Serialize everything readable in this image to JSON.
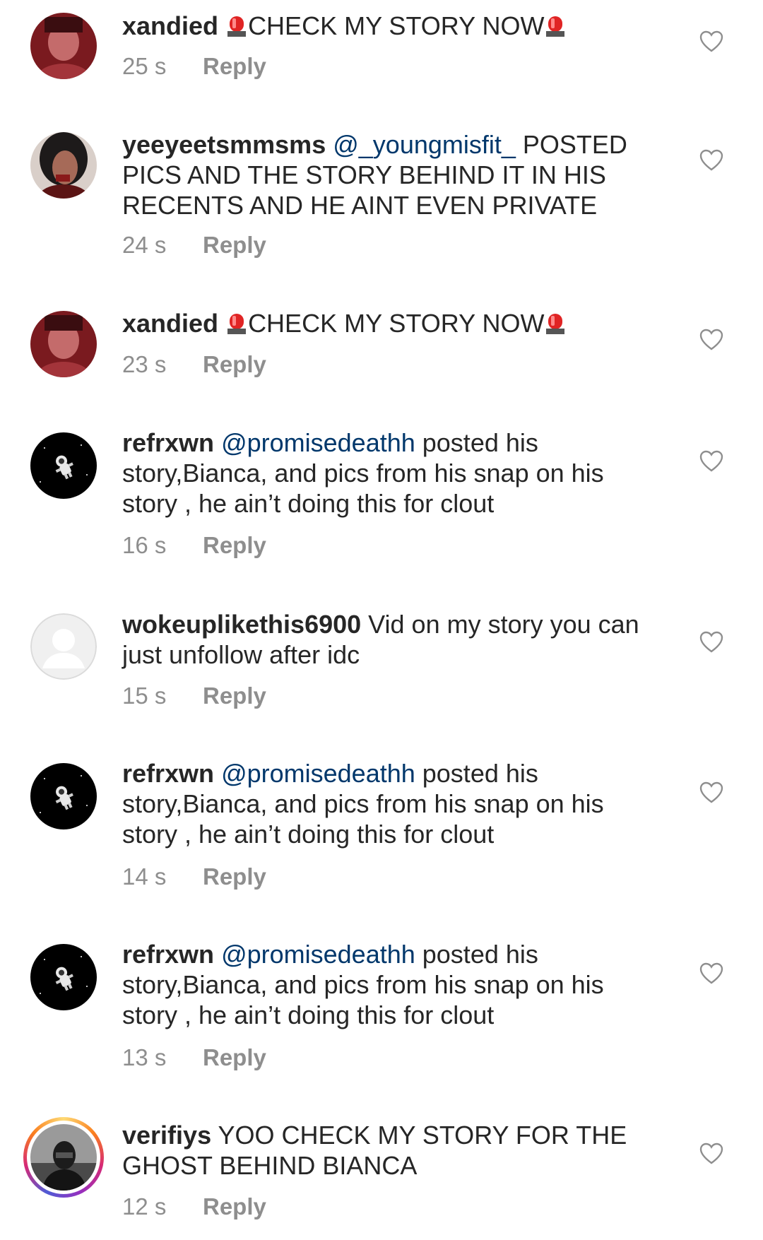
{
  "comments": [
    {
      "username": "xandied",
      "segments": [
        {
          "type": "emoji",
          "name": "police-light"
        },
        {
          "type": "text",
          "value": "CHECK MY STORY NOW"
        },
        {
          "type": "emoji",
          "name": "police-light"
        }
      ],
      "time": "25 s",
      "reply_label": "Reply",
      "avatar": "photo-selfie-red"
    },
    {
      "username": "yeeyeetsmmsms",
      "segments": [
        {
          "type": "mention",
          "value": "@_youngmisfit_"
        },
        {
          "type": "text",
          "value": " POSTED PICS AND THE STORY BEHIND IT IN HIS RECENTS AND HE AINT EVEN PRIVATE"
        }
      ],
      "time": "24 s",
      "reply_label": "Reply",
      "avatar": "photo-portrait-dark"
    },
    {
      "username": "xandied",
      "segments": [
        {
          "type": "emoji",
          "name": "police-light"
        },
        {
          "type": "text",
          "value": "CHECK MY STORY NOW"
        },
        {
          "type": "emoji",
          "name": "police-light"
        }
      ],
      "time": "23 s",
      "reply_label": "Reply",
      "avatar": "photo-selfie-red"
    },
    {
      "username": "refrxwn",
      "segments": [
        {
          "type": "mention",
          "value": "@promisedeathh"
        },
        {
          "type": "text",
          "value": " posted his story,Bianca, and pics from his snap on his story , he ain’t doing this for clout"
        }
      ],
      "time": "16 s",
      "reply_label": "Reply",
      "avatar": "astronaut-black"
    },
    {
      "username": "wokeuplikethis6900",
      "segments": [
        {
          "type": "text",
          "value": " Vid on my story you can just unfollow after idc"
        }
      ],
      "time": "15 s",
      "reply_label": "Reply",
      "avatar": "default-silhouette"
    },
    {
      "username": "refrxwn",
      "segments": [
        {
          "type": "mention",
          "value": "@promisedeathh"
        },
        {
          "type": "text",
          "value": " posted his story,Bianca, and pics from his snap on his story , he ain’t doing this for clout"
        }
      ],
      "time": "14 s",
      "reply_label": "Reply",
      "avatar": "astronaut-black"
    },
    {
      "username": "refrxwn",
      "segments": [
        {
          "type": "mention",
          "value": "@promisedeathh"
        },
        {
          "type": "text",
          "value": " posted his story,Bianca, and pics from his snap on his story , he ain’t doing this for clout"
        }
      ],
      "time": "13 s",
      "reply_label": "Reply",
      "avatar": "astronaut-black"
    },
    {
      "username": "verifiys",
      "segments": [
        {
          "type": "text",
          "value": " YOO CHECK MY STORY FOR THE GHOST BEHIND BIANCA"
        }
      ],
      "time": "12 s",
      "reply_label": "Reply",
      "avatar": "photo-masked-story-ring"
    }
  ],
  "colors": {
    "text": "#262626",
    "meta": "#8e8e8e",
    "mention": "#00376b",
    "heart_stroke": "#8e8e8e"
  }
}
